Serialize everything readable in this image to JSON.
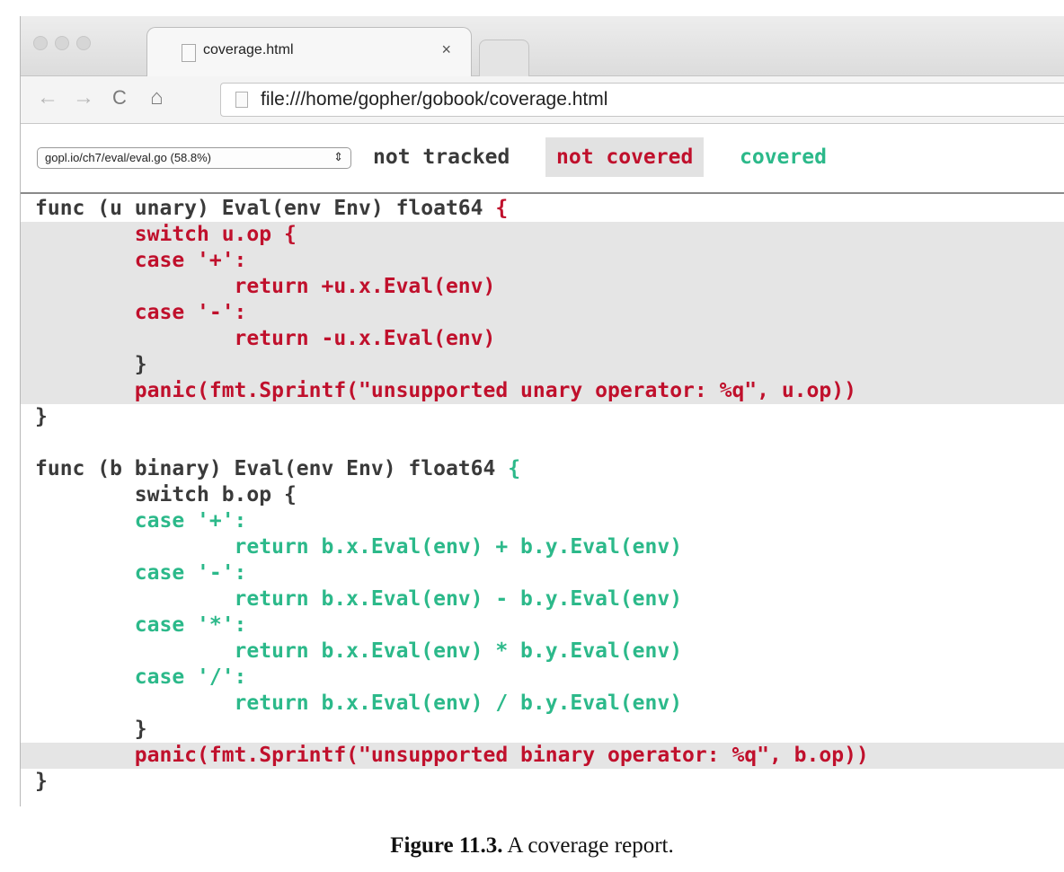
{
  "browser": {
    "tab_title": "coverage.html",
    "tab_close": "×",
    "back": "←",
    "forward": "→",
    "reload": "C",
    "home": "⌂",
    "url": "file:///home/gopher/gobook/coverage.html"
  },
  "coverage": {
    "file_select": "gopl.io/ch7/eval/eval.go (58.8%)",
    "select_arrows": "⇕",
    "legend_not_tracked": "not tracked",
    "legend_not_covered": "not covered",
    "legend_covered": "covered"
  },
  "colors": {
    "not_tracked": "#3a3a3a",
    "not_covered": "#c0102c",
    "covered": "#2cb98a",
    "highlight": "#e5e5e5"
  },
  "code": [
    [
      {
        "t": "func (u unary) Eval(env Env) float64 ",
        "c": "nt"
      },
      {
        "t": "{",
        "c": "nc"
      }
    ],
    [
      {
        "t": "        switch u.op {",
        "c": "nc"
      }
    ],
    [
      {
        "t": "        case '+':",
        "c": "nc"
      }
    ],
    [
      {
        "t": "                return +u.x.Eval(env)",
        "c": "nc"
      }
    ],
    [
      {
        "t": "        case '-':",
        "c": "nc"
      }
    ],
    [
      {
        "t": "                return -u.x.Eval(env)",
        "c": "nc"
      }
    ],
    [
      {
        "t": "        }",
        "c": "nt"
      }
    ],
    [
      {
        "t": "        panic(fmt.Sprintf(\"unsupported unary operator: %q\", u.op))",
        "c": "nc"
      }
    ],
    [
      {
        "t": "}",
        "c": "nt"
      }
    ],
    [],
    [
      {
        "t": "func (b binary) Eval(env Env) float64 ",
        "c": "nt"
      },
      {
        "t": "{",
        "c": "cv"
      }
    ],
    [
      {
        "t": "        switch b.op {",
        "c": "nt"
      }
    ],
    [
      {
        "t": "        case '+':",
        "c": "cv"
      }
    ],
    [
      {
        "t": "                return b.x.Eval(env) + b.y.Eval(env)",
        "c": "cv"
      }
    ],
    [
      {
        "t": "        case '-':",
        "c": "cv"
      }
    ],
    [
      {
        "t": "                return b.x.Eval(env) - b.y.Eval(env)",
        "c": "cv"
      }
    ],
    [
      {
        "t": "        case '*':",
        "c": "cv"
      }
    ],
    [
      {
        "t": "                return b.x.Eval(env) * b.y.Eval(env)",
        "c": "cv"
      }
    ],
    [
      {
        "t": "        case '/':",
        "c": "cv"
      }
    ],
    [
      {
        "t": "                return b.x.Eval(env) / b.y.Eval(env)",
        "c": "cv"
      }
    ],
    [
      {
        "t": "        }",
        "c": "nt"
      }
    ],
    [
      {
        "t": "        panic(fmt.Sprintf(\"unsupported binary operator: %q\", b.op))",
        "c": "nc"
      }
    ],
    [
      {
        "t": "}",
        "c": "nt"
      }
    ]
  ],
  "highlighted_lines": [
    1,
    2,
    3,
    4,
    5,
    6,
    7,
    21
  ],
  "caption": {
    "label": "Figure 11.3.",
    "text": "A coverage report."
  }
}
